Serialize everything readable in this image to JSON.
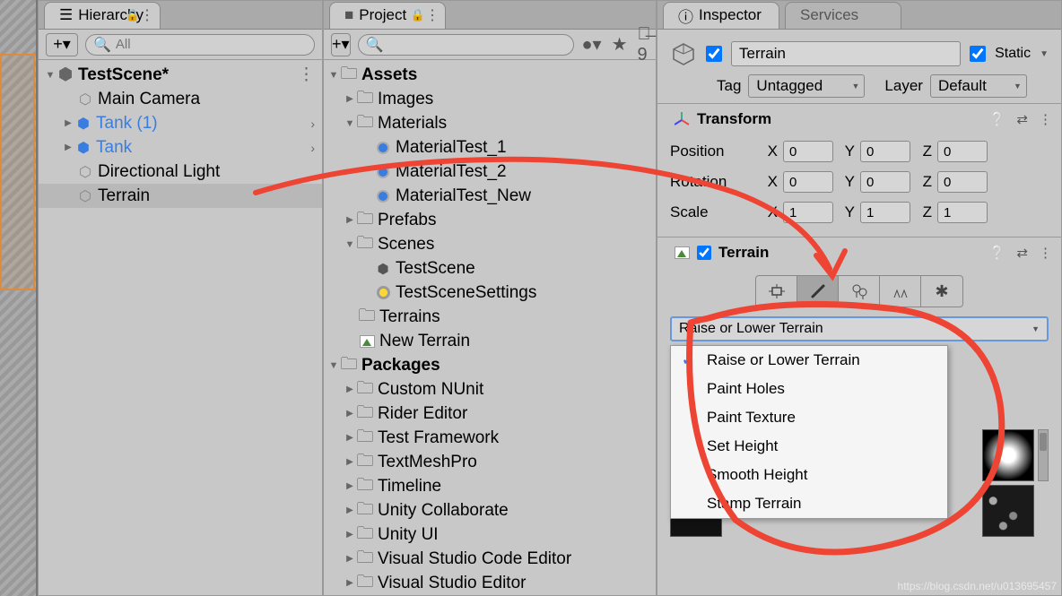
{
  "hierarchy": {
    "tab": "Hierarchy",
    "search_placeholder": "All",
    "scene": "TestScene*",
    "items": [
      {
        "label": "Main Camera",
        "icon": "cube-gray"
      },
      {
        "label": "Tank (1)",
        "icon": "cube-blue",
        "color": "blue",
        "expand": true
      },
      {
        "label": "Tank",
        "icon": "cube-blue",
        "color": "blue",
        "expand": true
      },
      {
        "label": "Directional Light",
        "icon": "cube-gray"
      },
      {
        "label": "Terrain",
        "icon": "cube-gray",
        "selected": true
      }
    ]
  },
  "project": {
    "tab": "Project",
    "search_placeholder": "",
    "hidden_count": "9",
    "root1": "Assets",
    "assets_children": [
      {
        "label": "Images",
        "folder": true,
        "closed": true
      },
      {
        "label": "Materials",
        "folder": true,
        "open": true
      }
    ],
    "materials": [
      "MaterialTest_1",
      "MaterialTest_2",
      "MaterialTest_New"
    ],
    "prefabs": "Prefabs",
    "scenes": "Scenes",
    "scene_items": [
      "TestScene",
      "TestSceneSettings"
    ],
    "terrains": "Terrains",
    "new_terrain": "New Terrain",
    "root2": "Packages",
    "packages": [
      "Custom NUnit",
      "Rider Editor",
      "Test Framework",
      "TextMeshPro",
      "Timeline",
      "Unity Collaborate",
      "Unity UI",
      "Visual Studio Code Editor",
      "Visual Studio Editor"
    ]
  },
  "inspector": {
    "tab": "Inspector",
    "tab2": "Services",
    "name": "Terrain",
    "static_label": "Static",
    "tag_label": "Tag",
    "tag_value": "Untagged",
    "layer_label": "Layer",
    "layer_value": "Default",
    "transform": {
      "title": "Transform",
      "position": {
        "label": "Position",
        "x": "0",
        "y": "0",
        "z": "0"
      },
      "rotation": {
        "label": "Rotation",
        "x": "0",
        "y": "0",
        "z": "0"
      },
      "scale": {
        "label": "Scale",
        "x": "1",
        "y": "1",
        "z": "1"
      }
    },
    "terrain": {
      "title": "Terrain",
      "dropdown_value": "Raise or Lower Terrain",
      "options": [
        "Raise or Lower Terrain",
        "Paint Holes",
        "Paint Texture",
        "Set Height",
        "Smooth Height",
        "Stamp Terrain"
      ]
    }
  },
  "watermark": "https://blog.csdn.net/u013695457"
}
